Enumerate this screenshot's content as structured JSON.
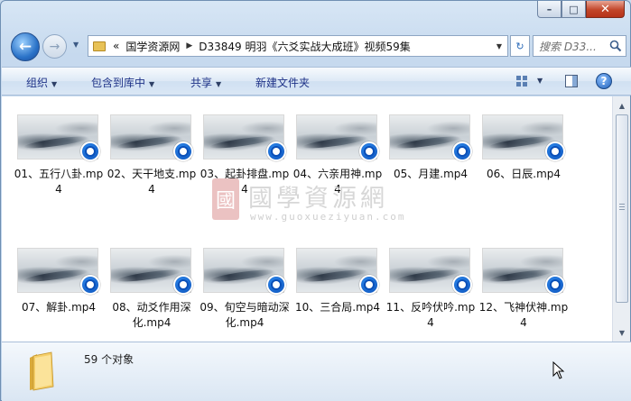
{
  "caption": {
    "minimize": "–",
    "maximize": "□",
    "close": "✕"
  },
  "nav": {
    "back": "←",
    "forward": "→",
    "breadcrumb_overflow": "«",
    "crumbs": [
      "国学资源网",
      "D33849 明羽《六爻实战大成班》视频59集"
    ],
    "search_placeholder": "搜索 D33...",
    "refresh": "↻"
  },
  "toolbar": {
    "organize": "组织",
    "include_library": "包含到库中",
    "share": "共享",
    "new_folder": "新建文件夹",
    "help": "?"
  },
  "files": [
    "01、五行八卦.mp4",
    "02、天干地支.mp4",
    "03、起卦排盘.mp4",
    "04、六亲用神.mp4",
    "05、月建.mp4",
    "06、日辰.mp4",
    "07、解卦.mp4",
    "08、动爻作用深化.mp4",
    "09、旬空与暗动深化.mp4",
    "10、三合局.mp4",
    "11、反吟伏吟.mp4",
    "12、飞神伏神.mp4"
  ],
  "watermark": {
    "seal": "國",
    "text": "國學資源網",
    "url": "www.guoxueziyuan.com"
  },
  "status": {
    "count": "59 个对象"
  },
  "colors": {
    "accent": "#1e3287",
    "play_icon": "#0a4fb8",
    "close": "#c2462a"
  }
}
